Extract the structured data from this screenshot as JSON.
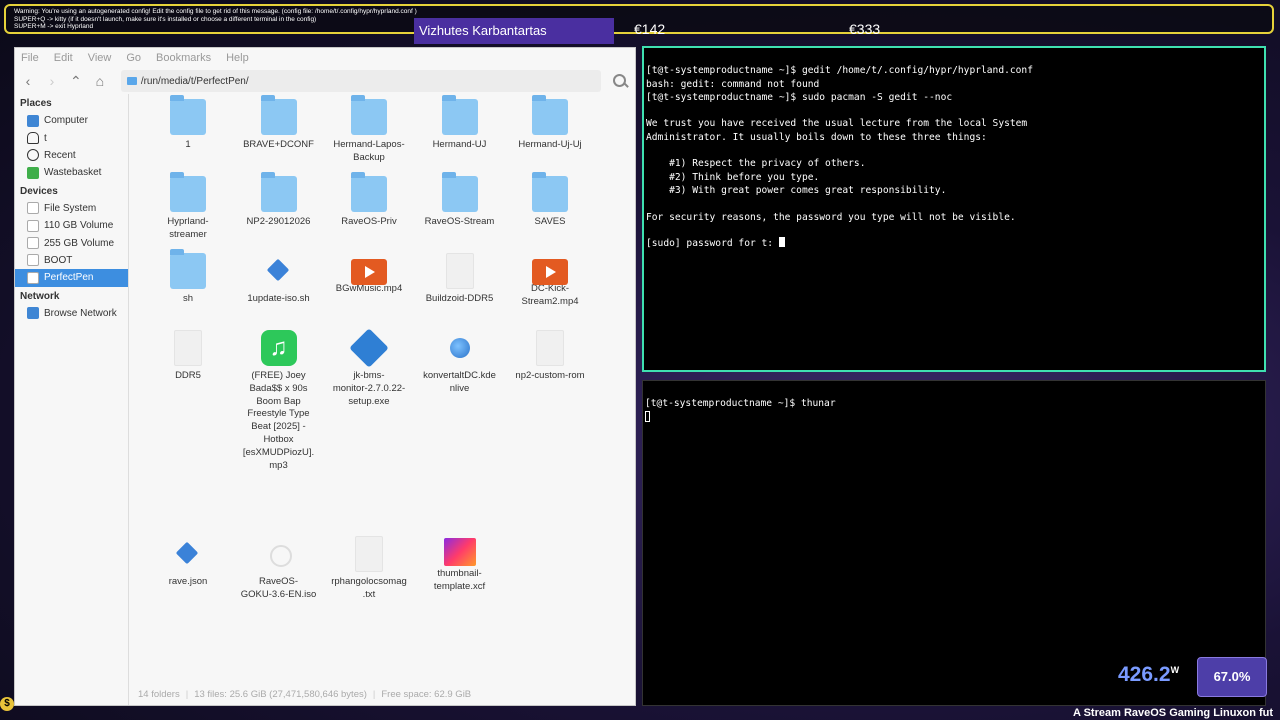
{
  "banner": {
    "lines": [
      "Warning: You're using an autogenerated config! Edit the config file to get rid of this message. (config file: /home/t/.config/hypr/hyprland.conf )",
      "SUPER+Q -> kitty (if it doesn't launch, make sure it's installed or choose a different terminal in the config)",
      "SUPER+M -> exit Hyprland"
    ]
  },
  "overlay": {
    "title": "Vizhutes Karbantartas",
    "price1": "€142",
    "price2": "€333"
  },
  "file_manager": {
    "menu": [
      "File",
      "Edit",
      "View",
      "Go",
      "Bookmarks",
      "Help"
    ],
    "path": "/run/media/t/PerfectPen/",
    "sidebar": {
      "places_heading": "Places",
      "places": [
        {
          "label": "Computer",
          "icon": "computer-icon"
        },
        {
          "label": "t",
          "icon": "home-icon"
        },
        {
          "label": "Recent",
          "icon": "recent-icon"
        },
        {
          "label": "Wastebasket",
          "icon": "trash-icon"
        }
      ],
      "devices_heading": "Devices",
      "devices": [
        {
          "label": "File System"
        },
        {
          "label": "110 GB Volume"
        },
        {
          "label": "255 GB Volume"
        },
        {
          "label": "BOOT"
        },
        {
          "label": "PerfectPen",
          "selected": true
        }
      ],
      "network_heading": "Network",
      "network": [
        {
          "label": "Browse Network"
        }
      ]
    },
    "items": [
      {
        "label": "1",
        "icon": "folder-icon"
      },
      {
        "label": "BRAVE+DCONF",
        "icon": "folder-icon"
      },
      {
        "label": "Hermand-Lapos-\nBackup",
        "icon": "folder-icon"
      },
      {
        "label": "Hermand-UJ",
        "icon": "folder-icon"
      },
      {
        "label": "Hermand-Uj-Uj",
        "icon": "folder-icon"
      },
      {
        "label": "Hyprland-\nstreamer",
        "icon": "folder-icon"
      },
      {
        "label": "NP2-29012026",
        "icon": "folder-icon"
      },
      {
        "label": "RaveOS-Priv",
        "icon": "folder-icon"
      },
      {
        "label": "RaveOS-Stream",
        "icon": "folder-icon"
      },
      {
        "label": "SAVES",
        "icon": "folder-icon"
      },
      {
        "label": "sh",
        "icon": "folder-icon"
      },
      {
        "label": "1update-iso.sh",
        "icon": "script-icon"
      },
      {
        "label": "BGwMusic.mp4",
        "icon": "video-icon"
      },
      {
        "label": "Buildzoid-DDR5",
        "icon": "blank-file-icon"
      },
      {
        "label": "DC-Kick-\nStream2.mp4",
        "icon": "video-icon"
      },
      {
        "label": "DDR5",
        "icon": "blank-file-icon"
      },
      {
        "label": "(FREE) Joey\nBada$$ x 90s\nBoom Bap\nFreestyle Type\nBeat [2025] -\nHotbox\n[esXMUDPiozU].\nmp3",
        "icon": "music-icon"
      },
      {
        "label": "jk-bms-\nmonitor-2.7.0.22-\nsetup.exe",
        "icon": "exe-icon"
      },
      {
        "label": "konvertaltDC.kde\nnlive",
        "icon": "globe-icon"
      },
      {
        "label": "np2-custom-rom",
        "icon": "blank-file-icon"
      },
      {
        "label": "rave.json",
        "icon": "script-icon"
      },
      {
        "label": "RaveOS-\nGOKU-3.6-EN.iso",
        "icon": "iso-icon"
      },
      {
        "label": "rphangolocsomag\n.txt",
        "icon": "blank-file-icon"
      },
      {
        "label": "thumbnail-\ntemplate.xcf",
        "icon": "image-icon"
      }
    ],
    "status": {
      "folders": "14 folders",
      "files": "13 files: 25.6 GiB (27,471,580,646 bytes)",
      "free": "Free space: 62.9 GiB"
    }
  },
  "terminal_top": {
    "lines": [
      "[t@t-systemproductname ~]$ gedit /home/t/.config/hypr/hyprland.conf",
      "bash: gedit: command not found",
      "[t@t-systemproductname ~]$ sudo pacman -S gedit --noc",
      "",
      "We trust you have received the usual lecture from the local System",
      "Administrator. It usually boils down to these three things:",
      "",
      "    #1) Respect the privacy of others.",
      "    #2) Think before you type.",
      "    #3) With great power comes great responsibility.",
      "",
      "For security reasons, the password you type will not be visible.",
      ""
    ],
    "prompt": "[sudo] password for t: "
  },
  "terminal_bottom": {
    "line": "[t@t-systemproductname ~]$ thunar"
  },
  "hud": {
    "power_value": "426.2",
    "power_unit": "W",
    "cpu_percent": "67.0%",
    "ticker": "A Stream RaveOS Gaming Linuxon fut"
  },
  "colors": {
    "banner_border": "#e6d23a",
    "terminal_focus_border": "#3fe0b0",
    "selection": "#3d8ee0",
    "overlay_bg": "#4a2fa0"
  }
}
